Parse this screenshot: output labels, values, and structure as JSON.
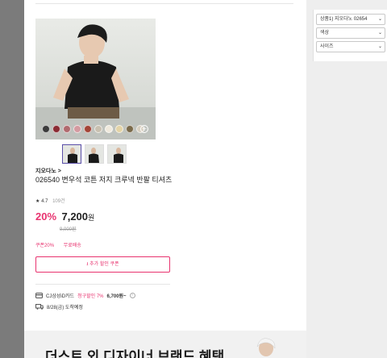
{
  "options": {
    "product_select": "상품1) 지오다노 02654",
    "color_select": "색상",
    "size_select": "사이즈"
  },
  "product": {
    "brand": "지오다노 >",
    "title": "026540 변우석 코튼 저지 크루넥 반팔 티셔츠",
    "rating": "4.7",
    "review_count": "109건",
    "discount": "20%",
    "price": "7,200",
    "currency": "원",
    "original_price": "9,000원",
    "swatches": [
      "#3b3b3b",
      "#8a2b33",
      "#b06a6e",
      "#d49aa0",
      "#a34437",
      "#c8c0b0",
      "#efe9dc",
      "#e3d3a6",
      "#7a6a4a",
      "#d7cfc0"
    ],
    "more_colors_icon": "+"
  },
  "benefits": {
    "coupon": "쿠폰20%",
    "free_shipping": "무료배송"
  },
  "coupon_button": "⭳ 추가 할인 쿠폰",
  "card_offer": {
    "prefix": "CJ삼성iD카드",
    "highlight": "청구할인 7%",
    "price": "6,700원~"
  },
  "shipping": {
    "text": "8/28(금) 도착예정"
  },
  "banner": {
    "text": "더스트 외 디자이너 브랜드 혜택"
  }
}
